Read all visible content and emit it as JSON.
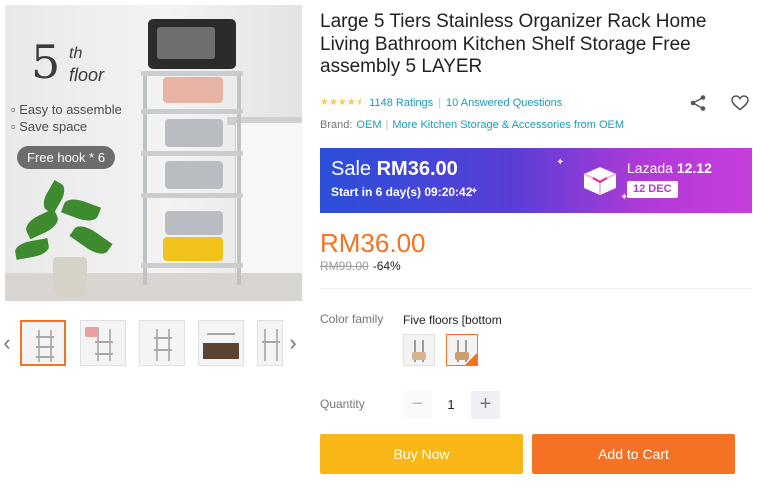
{
  "gallery": {
    "main_image": {
      "number": "5",
      "number_suffix": "th",
      "word": "floor",
      "features": [
        "Easy to assemble",
        "Save space"
      ],
      "badge": "Free hook * 6"
    },
    "thumbnail_count": 5,
    "active_thumbnail": 1
  },
  "product": {
    "title": "Large 5 Tiers Stainless Organizer Rack Home Living Bathroom Kitchen Shelf Storage Free assembly 5 LAYER",
    "rating_stars": 4.5,
    "ratings_text": "1148 Ratings",
    "questions_text": "10 Answered Questions",
    "brand_label": "Brand:",
    "brand_name": "OEM",
    "more_link": "More Kitchen Storage & Accessories from OEM"
  },
  "sale": {
    "label": "Sale",
    "price": "RM36.00",
    "countdown": "Start in 6 day(s) 09:20:42",
    "campaign_brand": "Lazada",
    "campaign_name": "12.12",
    "campaign_date": "12 DEC"
  },
  "pricing": {
    "current": "RM36.00",
    "original": "RM99.00",
    "discount": "-64%"
  },
  "variation": {
    "label": "Color family",
    "selected_value": "Five floors [bottom",
    "swatch_count": 2,
    "selected_index": 2
  },
  "quantity": {
    "label": "Quantity",
    "value": "1",
    "minus_symbol": "−",
    "plus_symbol": "+"
  },
  "actions": {
    "buy_now": "Buy Now",
    "add_to_cart": "Add to Cart"
  },
  "colors": {
    "accent": "#f57224",
    "buy_now": "#f8b716",
    "link": "#1a9cb7",
    "stars": "#faca51"
  }
}
